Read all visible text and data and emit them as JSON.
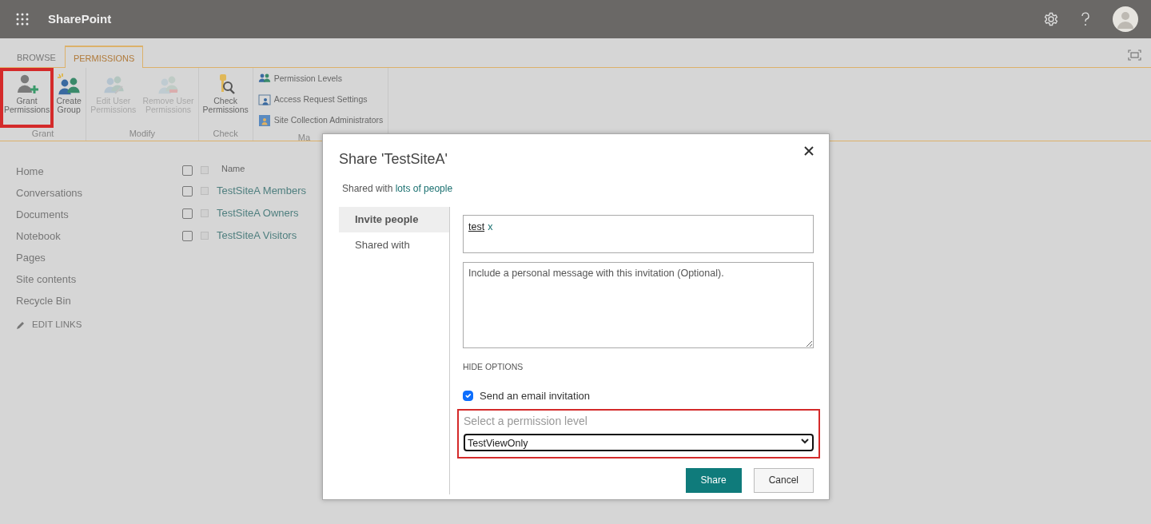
{
  "app": {
    "title": "SharePoint"
  },
  "ribbon": {
    "tabs": [
      {
        "label": "BROWSE",
        "selected": false
      },
      {
        "label": "PERMISSIONS",
        "selected": true
      }
    ],
    "groups": [
      {
        "label": "Grant",
        "buttons": [
          {
            "kind": "large",
            "lines": [
              "Grant",
              "Permissions"
            ],
            "disabled": false,
            "highlighted": true
          },
          {
            "kind": "large",
            "lines": [
              "Create",
              "Group"
            ],
            "disabled": false,
            "highlighted": false
          }
        ]
      },
      {
        "label": "Modify",
        "buttons": [
          {
            "kind": "large",
            "lines": [
              "Edit User",
              "Permissions"
            ],
            "disabled": true,
            "highlighted": false
          },
          {
            "kind": "large",
            "lines": [
              "Remove User",
              "Permissions"
            ],
            "disabled": true,
            "highlighted": false
          }
        ]
      },
      {
        "label": "Check",
        "buttons": [
          {
            "kind": "large",
            "lines": [
              "Check",
              "Permissions"
            ],
            "disabled": false,
            "highlighted": false
          }
        ]
      },
      {
        "label": "Ma",
        "buttons": [
          {
            "kind": "small",
            "lines": [
              "Permission Levels"
            ],
            "disabled": false
          },
          {
            "kind": "small",
            "lines": [
              "Access Request Settings"
            ],
            "disabled": false
          },
          {
            "kind": "small",
            "lines": [
              "Site Collection Administrators"
            ],
            "disabled": false
          }
        ]
      }
    ]
  },
  "sidebar": {
    "items": [
      "Home",
      "Conversations",
      "Documents",
      "Notebook",
      "Pages",
      "Site contents",
      "Recycle Bin"
    ],
    "edit_links": "EDIT LINKS"
  },
  "groups_list": {
    "column": "Name",
    "all_checked": false,
    "all_selected": false,
    "rows": [
      {
        "name": "TestSiteA Members",
        "checked": false,
        "selected": false
      },
      {
        "name": "TestSiteA Owners",
        "checked": false,
        "selected": false
      },
      {
        "name": "TestSiteA Visitors",
        "checked": false,
        "selected": false
      }
    ]
  },
  "dialog": {
    "title": "Share 'TestSiteA'",
    "shared_with": "Shared with",
    "shared_link": "lots of people",
    "tabs": [
      {
        "label": "Invite people",
        "selected": true
      },
      {
        "label": "Shared with",
        "selected": false
      }
    ],
    "invitees": [
      {
        "name": "test",
        "remove": "x"
      }
    ],
    "message": {
      "placeholder": "Include a personal message with this invitation (Optional)."
    },
    "options_toggle": "HIDE OPTIONS",
    "email_invitation": {
      "label": "Send an email invitation",
      "checked": true
    },
    "permission": {
      "label": "Select a permission level",
      "value": "TestViewOnly",
      "highlighted": true
    },
    "buttons": [
      {
        "label": "Share",
        "kind": "primary"
      },
      {
        "label": "Cancel",
        "kind": "secondary"
      }
    ]
  }
}
